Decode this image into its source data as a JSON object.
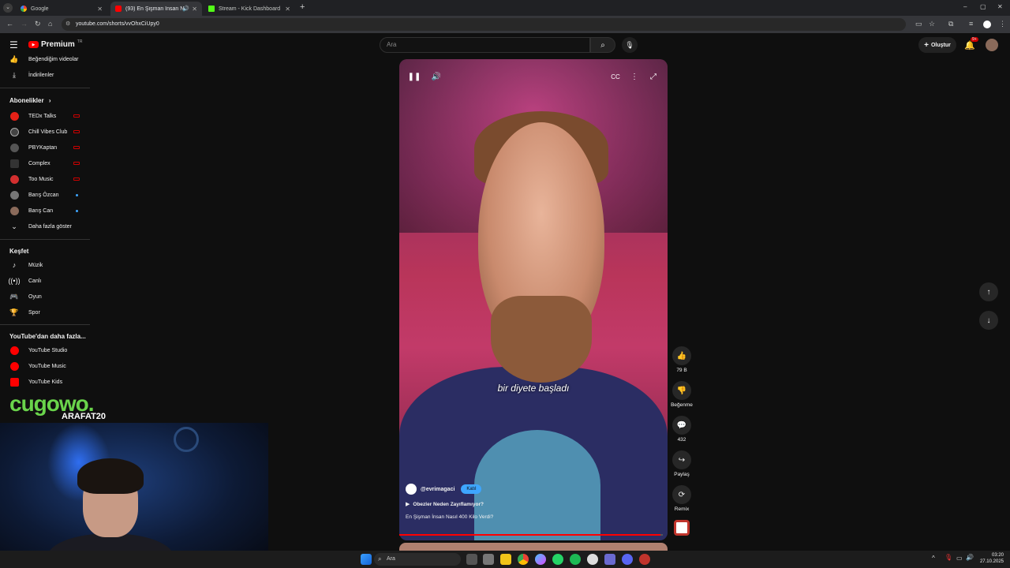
{
  "browser": {
    "tabs": [
      {
        "title": "Google",
        "active": false
      },
      {
        "title": "(93) En Şişman İnsan Nasıl...",
        "active": true
      },
      {
        "title": "Stream - Kick Dashboard",
        "active": false
      }
    ],
    "url": "youtube.com/shorts/vvOhxCiUpy0"
  },
  "header": {
    "logo_text": "Premium",
    "logo_sup": "TR",
    "search_placeholder": "Ara",
    "create_label": "Oluştur",
    "notif_badge": "9+"
  },
  "sidebar": {
    "top_items": [
      {
        "label": "Beğendiğim videolar",
        "icon": "like-icon"
      },
      {
        "label": "İndirilenler",
        "icon": "download-icon"
      }
    ],
    "subs_header": "Abonelikler",
    "subscriptions": [
      {
        "label": "TEDx Talks",
        "status": "live",
        "color": "#e62117"
      },
      {
        "label": "Chill Vibes Club",
        "status": "live",
        "color": "#444444"
      },
      {
        "label": "PBYKaptan",
        "status": "live",
        "color": "#555555"
      },
      {
        "label": "Complex",
        "status": "live",
        "color": "#333333"
      },
      {
        "label": "Too Music",
        "status": "live",
        "color": "#d32f2f"
      },
      {
        "label": "Barış Özcan",
        "status": "new",
        "color": "#777777"
      },
      {
        "label": "Barış Can",
        "status": "new",
        "color": "#8a6a5a"
      }
    ],
    "show_more": "Daha fazla göster",
    "explore_header": "Keşfet",
    "explore": [
      {
        "label": "Müzik",
        "icon": "music-icon"
      },
      {
        "label": "Canlı",
        "icon": "live-icon"
      },
      {
        "label": "Oyun",
        "icon": "gaming-icon"
      },
      {
        "label": "Spor",
        "icon": "trophy-icon"
      }
    ],
    "more_header": "YouTube'dan daha fazla...",
    "more": [
      {
        "label": "YouTube Studio"
      },
      {
        "label": "YouTube Music"
      },
      {
        "label": "YouTube Kids"
      }
    ]
  },
  "video": {
    "caption": "bir diyete başladı",
    "channel": "@evrimagaci",
    "join_label": "Katıl",
    "playlist": "Obezler Neden Zayıflamıyor?",
    "title": "En Şişman İnsan Nasıl 400 Kilo Verdi?",
    "progress": 0.99
  },
  "actions": {
    "likes": "79 B",
    "dislike": "Beğenme",
    "comments": "432",
    "share": "Paylaş",
    "remix": "Remix"
  },
  "overlay": {
    "logo": "cugowo.",
    "name": "ARAFAT20"
  },
  "taskbar": {
    "search": "Ara",
    "time": "03:20",
    "date": "27.10.2025"
  }
}
